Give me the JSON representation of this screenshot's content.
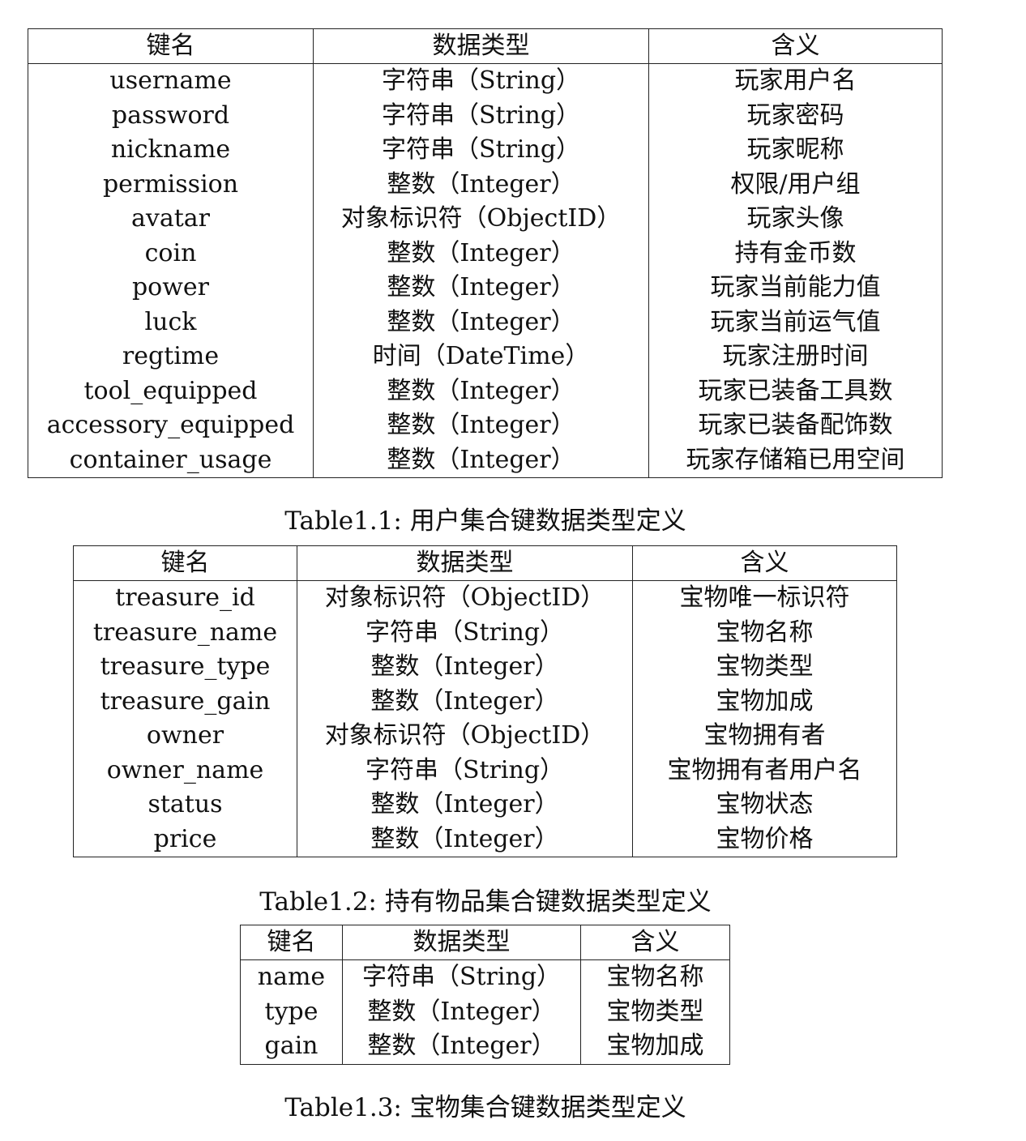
{
  "tables": [
    {
      "headers": [
        "键名",
        "数据类型",
        "含义"
      ],
      "rows": [
        [
          "username",
          "字符串（String）",
          "玩家用户名"
        ],
        [
          "password",
          "字符串（String）",
          "玩家密码"
        ],
        [
          "nickname",
          "字符串（String）",
          "玩家昵称"
        ],
        [
          "permission",
          "整数（Integer）",
          "权限/用户组"
        ],
        [
          "avatar",
          "对象标识符（ObjectID）",
          "玩家头像"
        ],
        [
          "coin",
          "整数（Integer）",
          "持有金币数"
        ],
        [
          "power",
          "整数（Integer）",
          "玩家当前能力值"
        ],
        [
          "luck",
          "整数（Integer）",
          "玩家当前运气值"
        ],
        [
          "regtime",
          "时间（DateTime）",
          "玩家注册时间"
        ],
        [
          "tool_equipped",
          "整数（Integer）",
          "玩家已装备工具数"
        ],
        [
          "accessory_equipped",
          "整数（Integer）",
          "玩家已装备配饰数"
        ],
        [
          "container_usage",
          "整数（Integer）",
          "玩家存储箱已用空间"
        ]
      ],
      "caption": "Table1.1: 用户集合键数据类型定义"
    },
    {
      "headers": [
        "键名",
        "数据类型",
        "含义"
      ],
      "rows": [
        [
          "treasure_id",
          "对象标识符（ObjectID）",
          "宝物唯一标识符"
        ],
        [
          "treasure_name",
          "字符串（String）",
          "宝物名称"
        ],
        [
          "treasure_type",
          "整数（Integer）",
          "宝物类型"
        ],
        [
          "treasure_gain",
          "整数（Integer）",
          "宝物加成"
        ],
        [
          "owner",
          "对象标识符（ObjectID）",
          "宝物拥有者"
        ],
        [
          "owner_name",
          "字符串（String）",
          "宝物拥有者用户名"
        ],
        [
          "status",
          "整数（Integer）",
          "宝物状态"
        ],
        [
          "price",
          "整数（Integer）",
          "宝物价格"
        ]
      ],
      "caption": "Table1.2: 持有物品集合键数据类型定义"
    },
    {
      "headers": [
        "键名",
        "数据类型",
        "含义"
      ],
      "rows": [
        [
          "name",
          "字符串（String）",
          "宝物名称"
        ],
        [
          "type",
          "整数（Integer）",
          "宝物类型"
        ],
        [
          "gain",
          "整数（Integer）",
          "宝物加成"
        ]
      ],
      "caption": "Table1.3: 宝物集合键数据类型定义"
    }
  ]
}
